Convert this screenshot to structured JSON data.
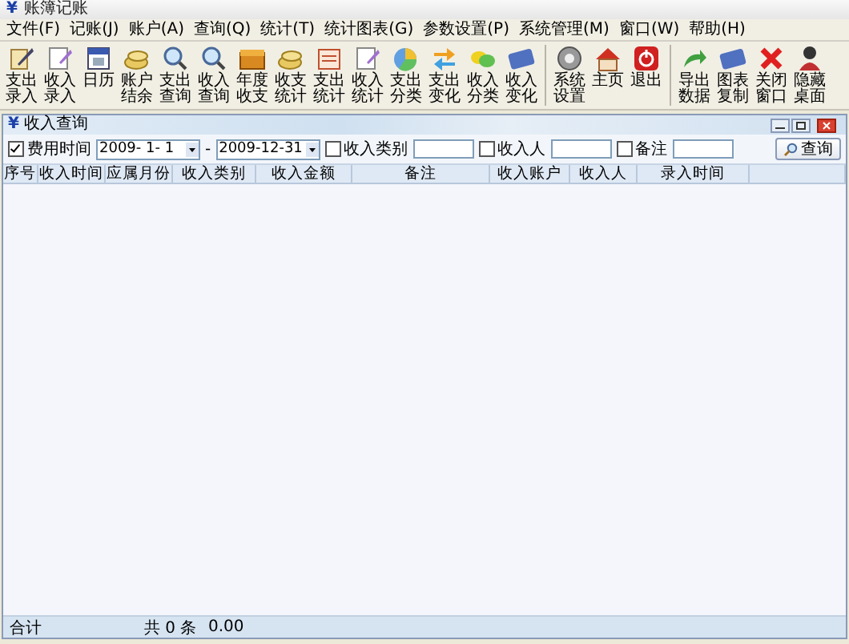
{
  "window": {
    "icon": "¥",
    "title": "账簿记账"
  },
  "menu": [
    "文件(F)",
    "记账(J)",
    "账户(A)",
    "查询(Q)",
    "统计(T)",
    "统计图表(G)",
    "参数设置(P)",
    "系统管理(M)",
    "窗口(W)",
    "帮助(H)"
  ],
  "toolbar": [
    {
      "label": "支出录入",
      "separator_before": false
    },
    {
      "label": "收入录入",
      "separator_before": false
    },
    {
      "label": "日历",
      "separator_before": false
    },
    {
      "label": "账户结余",
      "separator_before": false
    },
    {
      "label": "支出查询",
      "separator_before": false
    },
    {
      "label": "收入查询",
      "separator_before": false
    },
    {
      "label": "年度收支",
      "separator_before": false
    },
    {
      "label": "收支统计",
      "separator_before": false
    },
    {
      "label": "支出统计",
      "separator_before": false
    },
    {
      "label": "收入统计",
      "separator_before": false
    },
    {
      "label": "支出分类",
      "separator_before": false
    },
    {
      "label": "支出变化",
      "separator_before": false
    },
    {
      "label": "收入分类",
      "separator_before": false
    },
    {
      "label": "收入变化",
      "separator_before": false
    },
    {
      "label": "系统设置",
      "separator_before": true
    },
    {
      "label": "主页",
      "separator_before": false
    },
    {
      "label": "退出",
      "separator_before": false
    },
    {
      "label": "导出数据",
      "separator_before": true
    },
    {
      "label": "图表复制",
      "separator_before": false
    },
    {
      "label": "关闭窗口",
      "separator_before": false
    },
    {
      "label": "隐藏桌面",
      "separator_before": false
    }
  ],
  "child_window": {
    "icon": "¥",
    "title": "收入查询",
    "filters": {
      "date": {
        "checked": true,
        "label": "费用时间",
        "from": "2009- 1- 1",
        "separator": "-",
        "to": "2009-12-31"
      },
      "fields": [
        {
          "label": "收入类别",
          "checked": false
        },
        {
          "label": "收入人",
          "checked": false
        },
        {
          "label": "备注",
          "checked": false
        }
      ],
      "search_button": "查询"
    },
    "table": {
      "columns": [
        "序号",
        "收入时间",
        "应属月份",
        "收入类别",
        "收入金额",
        "备注",
        "收入账户",
        "收入人",
        "录入时间"
      ]
    },
    "footer": {
      "label": "合计",
      "count": "共 0 条",
      "sum": "0.00"
    }
  }
}
